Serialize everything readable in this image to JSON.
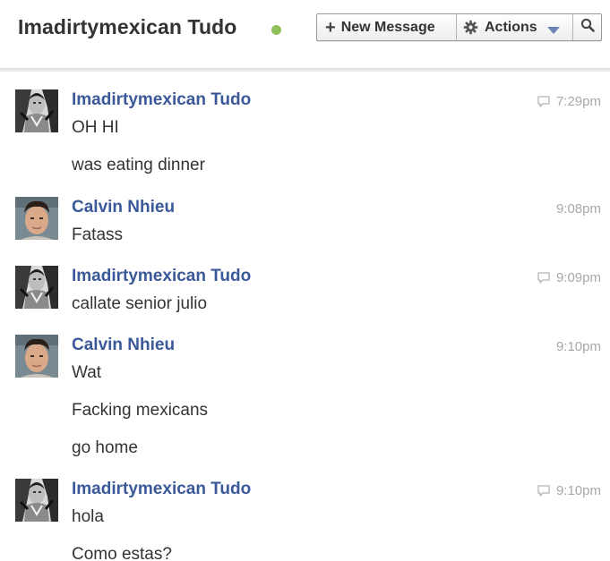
{
  "header": {
    "title": "Imadirtymexican Tudo",
    "online_color": "#90c05a",
    "new_message_label": "New Message",
    "actions_label": "Actions",
    "icons": {
      "new_message": "plus-icon",
      "actions": "gear-icon",
      "actions_menu": "caret-down-icon",
      "search": "search-icon"
    }
  },
  "colors": {
    "sender_name": "#3b5998",
    "timestamp": "#a8a8a8",
    "message_text": "#333333"
  },
  "groups": [
    {
      "sender": "Imadirtymexican Tudo",
      "time": "7:29pm",
      "show_reply_icon": true,
      "avatar": "avatar-imadirtymexican",
      "messages": [
        "OH HI",
        "was eating dinner"
      ]
    },
    {
      "sender": "Calvin Nhieu",
      "time": "9:08pm",
      "show_reply_icon": false,
      "avatar": "avatar-calvin",
      "messages": [
        "Fatass"
      ]
    },
    {
      "sender": "Imadirtymexican Tudo",
      "time": "9:09pm",
      "show_reply_icon": true,
      "avatar": "avatar-imadirtymexican",
      "messages": [
        "callate senior julio"
      ]
    },
    {
      "sender": "Calvin Nhieu",
      "time": "9:10pm",
      "show_reply_icon": false,
      "avatar": "avatar-calvin",
      "messages": [
        "Wat",
        "Facking mexicans",
        "go home"
      ]
    },
    {
      "sender": "Imadirtymexican Tudo",
      "time": "9:10pm",
      "show_reply_icon": true,
      "avatar": "avatar-imadirtymexican",
      "messages": [
        "hola",
        "Como estas?"
      ]
    }
  ]
}
